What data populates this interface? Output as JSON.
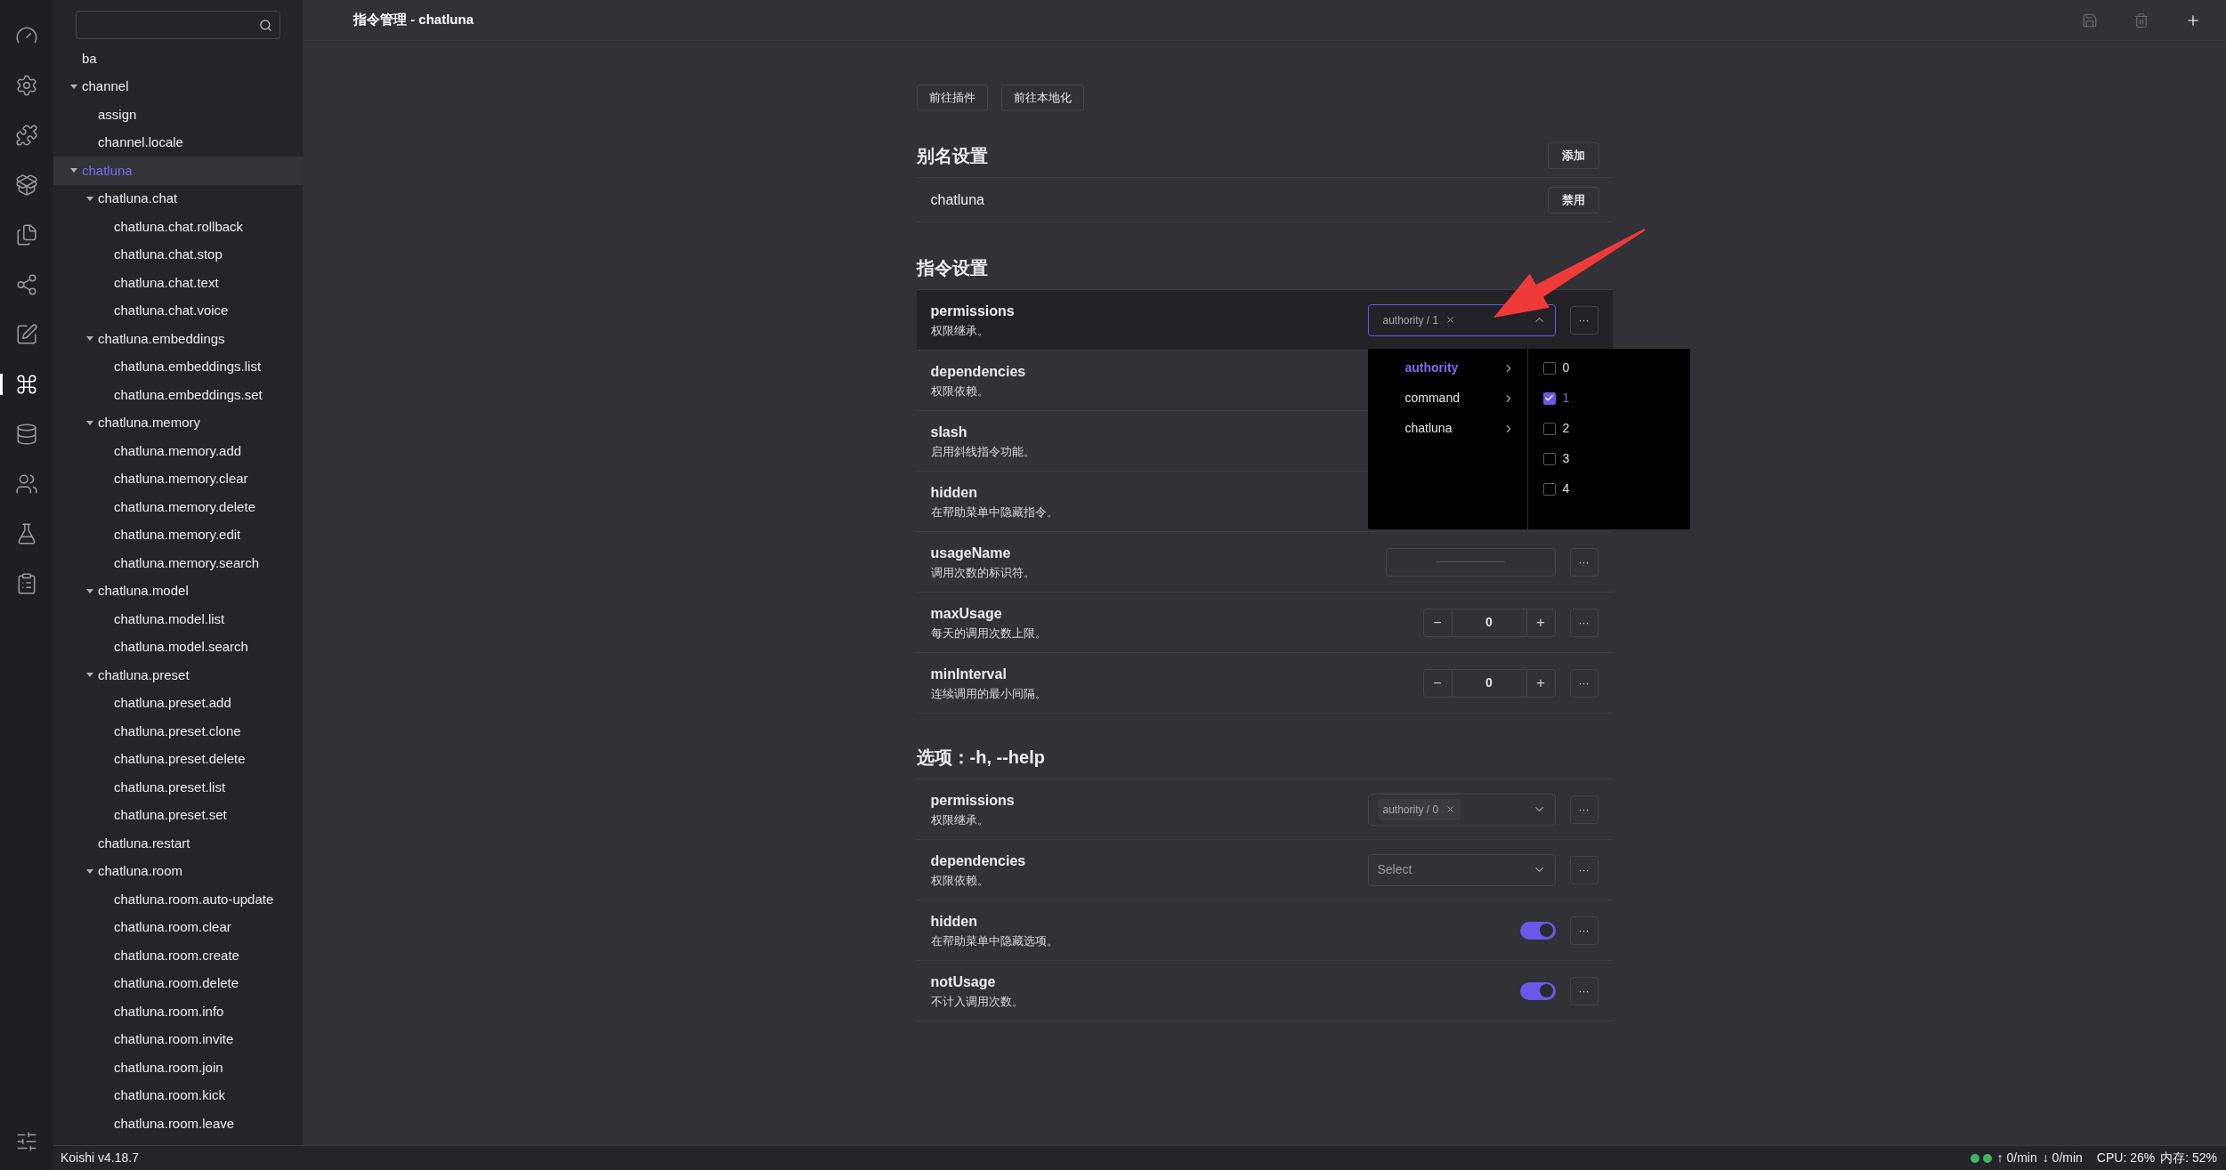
{
  "activity_bar": [
    {
      "selected": false
    },
    {
      "selected": false
    },
    {
      "selected": false
    },
    {
      "selected": false
    },
    {
      "selected": false
    },
    {
      "selected": false
    },
    {
      "selected": false
    },
    {
      "selected": true
    },
    {
      "selected": false
    },
    {
      "selected": false
    },
    {
      "selected": false
    },
    {
      "selected": false
    },
    {
      "selected": false
    }
  ],
  "tree": [
    {
      "label": "ba",
      "selected": false
    },
    {
      "label": "channel",
      "selected": false,
      "expanded": true,
      "children": [
        {
          "label": "assign",
          "selected": false
        },
        {
          "label": "channel.locale",
          "selected": false
        }
      ]
    },
    {
      "label": "chatluna",
      "selected": true,
      "expanded": true,
      "children": [
        {
          "label": "chatluna.chat",
          "selected": false,
          "expanded": true,
          "children": [
            {
              "label": "chatluna.chat.rollback",
              "selected": false
            },
            {
              "label": "chatluna.chat.stop",
              "selected": false
            },
            {
              "label": "chatluna.chat.text",
              "selected": false
            },
            {
              "label": "chatluna.chat.voice",
              "selected": false
            }
          ]
        },
        {
          "label": "chatluna.embeddings",
          "selected": false,
          "expanded": true,
          "children": [
            {
              "label": "chatluna.embeddings.list",
              "selected": false
            },
            {
              "label": "chatluna.embeddings.set",
              "selected": false
            }
          ]
        },
        {
          "label": "chatluna.memory",
          "selected": false,
          "expanded": true,
          "children": [
            {
              "label": "chatluna.memory.add",
              "selected": false
            },
            {
              "label": "chatluna.memory.clear",
              "selected": false
            },
            {
              "label": "chatluna.memory.delete",
              "selected": false
            },
            {
              "label": "chatluna.memory.edit",
              "selected": false
            },
            {
              "label": "chatluna.memory.search",
              "selected": false
            }
          ]
        },
        {
          "label": "chatluna.model",
          "selected": false,
          "expanded": true,
          "children": [
            {
              "label": "chatluna.model.list",
              "selected": false
            },
            {
              "label": "chatluna.model.search",
              "selected": false
            }
          ]
        },
        {
          "label": "chatluna.preset",
          "selected": false,
          "expanded": true,
          "children": [
            {
              "label": "chatluna.preset.add",
              "selected": false
            },
            {
              "label": "chatluna.preset.clone",
              "selected": false
            },
            {
              "label": "chatluna.preset.delete",
              "selected": false
            },
            {
              "label": "chatluna.preset.list",
              "selected": false
            },
            {
              "label": "chatluna.preset.set",
              "selected": false
            }
          ]
        },
        {
          "label": "chatluna.restart",
          "selected": false
        },
        {
          "label": "chatluna.room",
          "selected": false,
          "expanded": true,
          "children": [
            {
              "label": "chatluna.room.auto-update",
              "selected": false
            },
            {
              "label": "chatluna.room.clear",
              "selected": false
            },
            {
              "label": "chatluna.room.create",
              "selected": false
            },
            {
              "label": "chatluna.room.delete",
              "selected": false
            },
            {
              "label": "chatluna.room.info",
              "selected": false
            },
            {
              "label": "chatluna.room.invite",
              "selected": false
            },
            {
              "label": "chatluna.room.join",
              "selected": false
            },
            {
              "label": "chatluna.room.kick",
              "selected": false
            },
            {
              "label": "chatluna.room.leave",
              "selected": false
            }
          ]
        }
      ]
    }
  ],
  "header": {
    "title": "指令管理 - chatluna",
    "tools": [
      {
        "disabled": true
      },
      {
        "disabled": true
      },
      {
        "disabled": false
      }
    ]
  },
  "links": [
    "前往插件",
    "前往本地化"
  ],
  "alias_section": {
    "title": "别名设置",
    "add_button": "添加",
    "aliases": [
      {
        "name": "chatluna",
        "button": "禁用"
      }
    ]
  },
  "sections": [
    {
      "title": "指令设置",
      "rows": [
        {
          "name": "permissions",
          "description": "权限继承。",
          "kind": "select",
          "highlighted": true,
          "open": true,
          "tags": [
            "authority / 1"
          ]
        },
        {
          "name": "dependencies",
          "description": "权限依赖。",
          "kind": "covered"
        },
        {
          "name": "slash",
          "description": "启用斜线指令功能。",
          "kind": "covered"
        },
        {
          "name": "hidden",
          "description": "在帮助菜单中隐藏指令。",
          "kind": "covered"
        },
        {
          "name": "usageName",
          "description": "调用次数的标识符。",
          "kind": "text"
        },
        {
          "name": "maxUsage",
          "description": "每天的调用次数上限。",
          "kind": "number",
          "value": "0",
          "minus": "−",
          "plus": "+"
        },
        {
          "name": "minInterval",
          "description": "连续调用的最小间隔。",
          "kind": "number",
          "value": "0",
          "minus": "−",
          "plus": "+"
        }
      ]
    },
    {
      "title": "选项：-h, --help",
      "rows": [
        {
          "name": "permissions",
          "description": "权限继承。",
          "kind": "select",
          "open": false,
          "tags": [
            "authority / 0"
          ]
        },
        {
          "name": "dependencies",
          "description": "权限依赖。",
          "kind": "select",
          "open": false,
          "placeholder": "Select"
        },
        {
          "name": "hidden",
          "description": "在帮助菜单中隐藏选项。",
          "kind": "toggle",
          "on": true
        },
        {
          "name": "notUsage",
          "description": "不计入调用次数。",
          "kind": "toggle",
          "on": true
        }
      ]
    }
  ],
  "more_button": "···",
  "popup": {
    "categories": [
      {
        "label": "authority",
        "selected": true
      },
      {
        "label": "command",
        "selected": false
      },
      {
        "label": "chatluna",
        "selected": false
      }
    ],
    "options": [
      {
        "label": "0",
        "checked": false
      },
      {
        "label": "1",
        "checked": true
      },
      {
        "label": "2",
        "checked": false
      },
      {
        "label": "3",
        "checked": false
      },
      {
        "label": "4",
        "checked": false
      }
    ]
  },
  "status_bar": {
    "version": "Koishi v4.18.7",
    "dots": [
      {
        "color": "#3fb55f"
      },
      {
        "color": "#3fb55f"
      }
    ],
    "sent": "↑ 0/min",
    "received": "↓ 0/min",
    "cpu": "CPU: 26%",
    "memory": "内存: 52%"
  }
}
